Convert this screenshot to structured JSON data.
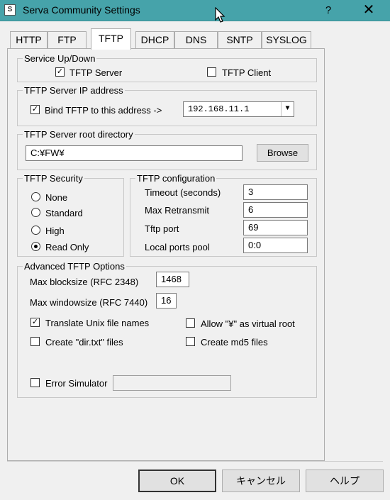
{
  "window": {
    "title": "Serva Community Settings",
    "app_icon_glyph": "S",
    "help_glyph": "?",
    "close_glyph": "✕"
  },
  "tabs": [
    {
      "label": "HTTP",
      "active": false
    },
    {
      "label": "FTP",
      "active": false
    },
    {
      "label": "TFTP",
      "active": true
    },
    {
      "label": "DHCP",
      "active": false
    },
    {
      "label": "DNS",
      "active": false
    },
    {
      "label": "SNTP",
      "active": false
    },
    {
      "label": "SYSLOG",
      "active": false
    }
  ],
  "service": {
    "legend": "Service Up/Down",
    "tftp_server_label": "TFTP Server",
    "tftp_server_checked": true,
    "tftp_client_label": "TFTP Client",
    "tftp_client_checked": false
  },
  "ip": {
    "legend": "TFTP Server IP address",
    "bind_label": "Bind TFTP to this address  ->",
    "bind_checked": true,
    "address": "192.168.11.1"
  },
  "root": {
    "legend": "TFTP Server root directory",
    "path": "C:¥FW¥",
    "browse_label": "Browse"
  },
  "security": {
    "legend": "TFTP Security",
    "options": [
      {
        "label": "None",
        "selected": false
      },
      {
        "label": "Standard",
        "selected": false
      },
      {
        "label": "High",
        "selected": false
      },
      {
        "label": "Read Only",
        "selected": true
      }
    ]
  },
  "config": {
    "legend": "TFTP configuration",
    "timeout_label": "Timeout (seconds)",
    "timeout_value": "3",
    "retransmit_label": "Max Retransmit",
    "retransmit_value": "6",
    "port_label": "Tftp port",
    "port_value": "69",
    "pool_label": "Local ports pool",
    "pool_value": "0:0"
  },
  "advanced": {
    "legend": "Advanced TFTP Options",
    "blocksize_label": "Max blocksize (RFC 2348)",
    "blocksize_value": "1468",
    "windowsize_label": "Max windowsize (RFC 7440)",
    "windowsize_value": "16",
    "translate_label": "Translate Unix file names",
    "translate_checked": true,
    "virtual_root_label": "Allow \"¥\" as virtual root",
    "virtual_root_checked": false,
    "dirtxt_label": "Create \"dir.txt\" files",
    "dirtxt_checked": false,
    "md5_label": "Create md5 files",
    "md5_checked": false,
    "error_sim_label": "Error Simulator",
    "error_sim_checked": false,
    "error_sim_value": ""
  },
  "buttons": {
    "ok": "OK",
    "cancel": "キャンセル",
    "help": "ヘルプ"
  }
}
